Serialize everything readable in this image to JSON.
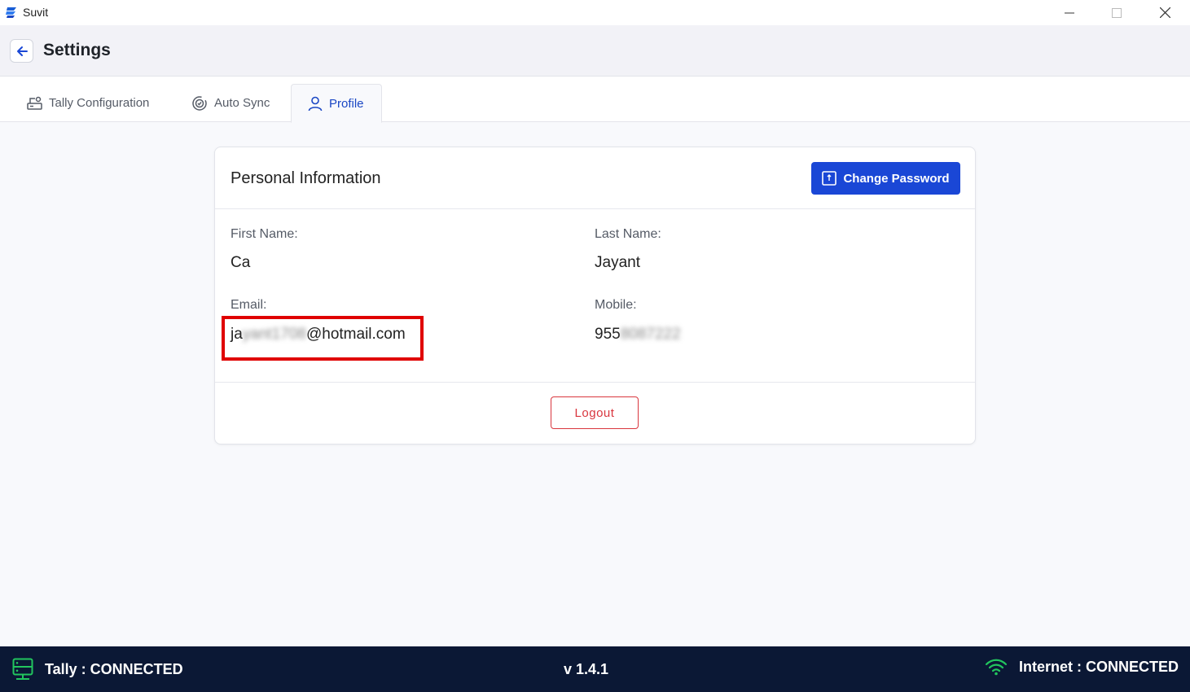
{
  "window": {
    "title": "Suvit"
  },
  "header": {
    "title": "Settings"
  },
  "tabs": [
    {
      "label": "Tally Configuration",
      "icon": "tally-config-icon"
    },
    {
      "label": "Auto Sync",
      "icon": "sync-icon"
    },
    {
      "label": "Profile",
      "icon": "user-icon",
      "active": true
    }
  ],
  "card": {
    "title": "Personal Information",
    "change_password_label": "Change Password",
    "first_name_label": "First Name:",
    "first_name_value": "Ca",
    "last_name_label": "Last Name:",
    "last_name_value": "Jayant",
    "email_label": "Email:",
    "email_prefix": "ja",
    "email_hidden": "yant1708",
    "email_suffix": "@hotmail.com",
    "mobile_label": "Mobile:",
    "mobile_prefix": "955",
    "mobile_hidden": "8087222",
    "logout_label": "Logout"
  },
  "status": {
    "tally": "Tally : CONNECTED",
    "version": "v 1.4.1",
    "internet": "Internet : CONNECTED"
  },
  "colors": {
    "primary": "#1a47d6",
    "danger": "#d9363e",
    "statusbar": "#0b1835",
    "connected": "#22c55e",
    "highlight": "#e00000"
  }
}
